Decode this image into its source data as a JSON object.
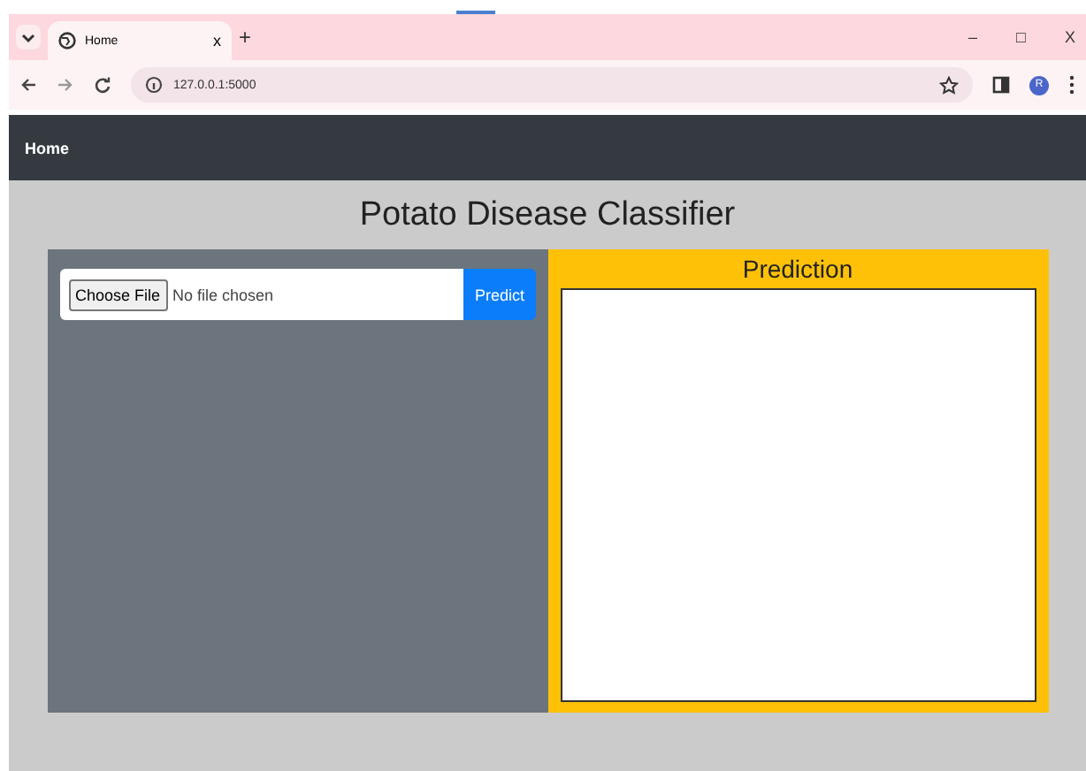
{
  "browser": {
    "tab": {
      "title": "Home",
      "close": "x"
    },
    "new_tab": "+",
    "address": "127.0.0.1:5000",
    "window_controls": [
      "–",
      "□",
      "X"
    ],
    "avatar": "R"
  },
  "navbar": {
    "brand": "Home"
  },
  "page": {
    "title": "Potato Disease Classifier",
    "upload": {
      "choose_button": "Choose File",
      "file_status": "No file chosen",
      "submit": "Predict"
    },
    "prediction": {
      "heading": "Prediction"
    }
  }
}
